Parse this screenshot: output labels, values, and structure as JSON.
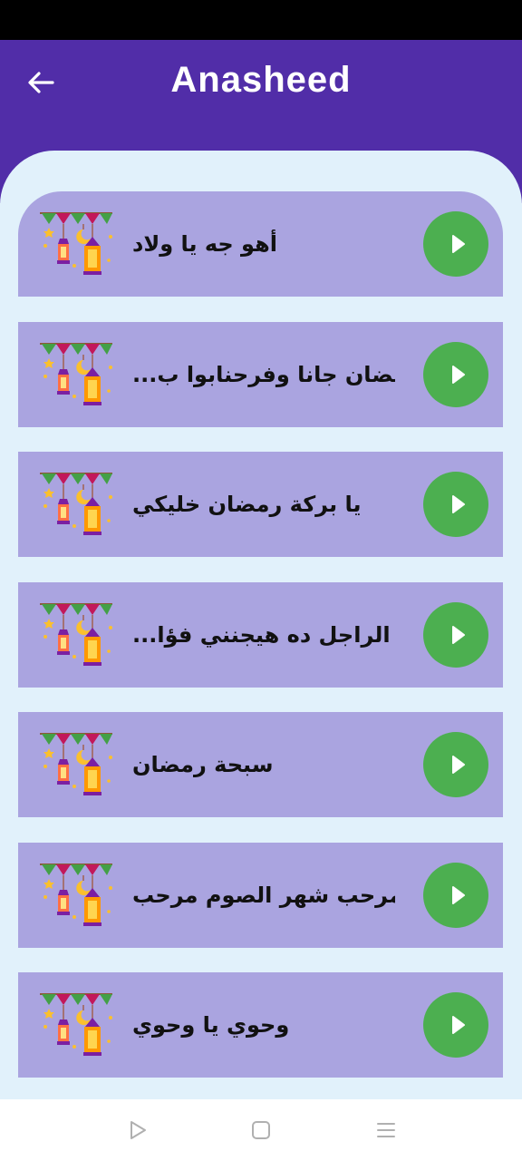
{
  "app_bar": {
    "title": "Anasheed",
    "back_icon": "arrow-left-icon"
  },
  "colors": {
    "primary": "#512da8",
    "panel": "#e1f1fb",
    "card": "#aaa4e0",
    "play": "#4caf50"
  },
  "songs": [
    {
      "title": "أهو جه يا ولاد"
    },
    {
      "title": "رمضان جانا وفرحنابوا ب..."
    },
    {
      "title": "يا بركة رمضان خليكي"
    },
    {
      "title": "الراجل ده هيجنني فؤا..."
    },
    {
      "title": "سبحة رمضان"
    },
    {
      "title": "مرحب شهر الصوم مرحب"
    },
    {
      "title": "وحوي يا وحوي"
    }
  ],
  "song_item": {
    "art_icon": "ramadan-lantern-icon",
    "play_icon": "play-icon"
  },
  "nav_bar": {
    "back_icon": "triangle-back-icon",
    "home_icon": "square-home-icon",
    "menu_icon": "three-lines-menu-icon"
  }
}
